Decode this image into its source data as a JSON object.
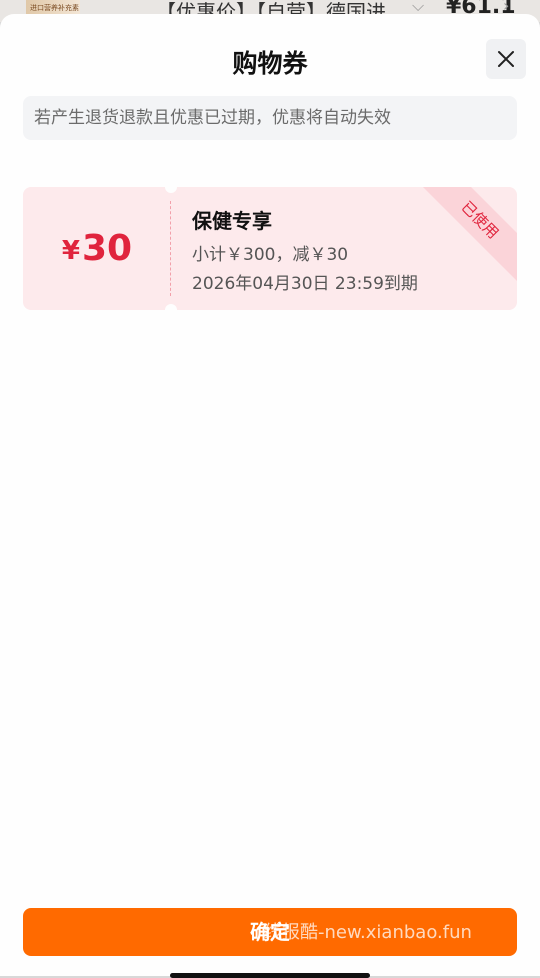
{
  "background": {
    "thumb_text": "进口营养补充素",
    "title": "【优惠价】【自营】德国进",
    "price": "¥61.1"
  },
  "sheet": {
    "title": "购物券",
    "notice": "若产生退货退款且优惠已过期，优惠将自动失效"
  },
  "coupon": {
    "currency": "¥",
    "amount": "30",
    "name": "保健专享",
    "condition": "小计￥300，减￥30",
    "expiry": "2026年04月30日 23:59到期",
    "status": "已使用"
  },
  "footer": {
    "confirm_label": "确定",
    "watermark": "线报酷-new.xianbao.fun"
  },
  "colors": {
    "accent": "#ff6a00",
    "coupon_red": "#e0243d",
    "coupon_bg": "#fdeaec"
  },
  "icons": {
    "close": "close-icon"
  }
}
